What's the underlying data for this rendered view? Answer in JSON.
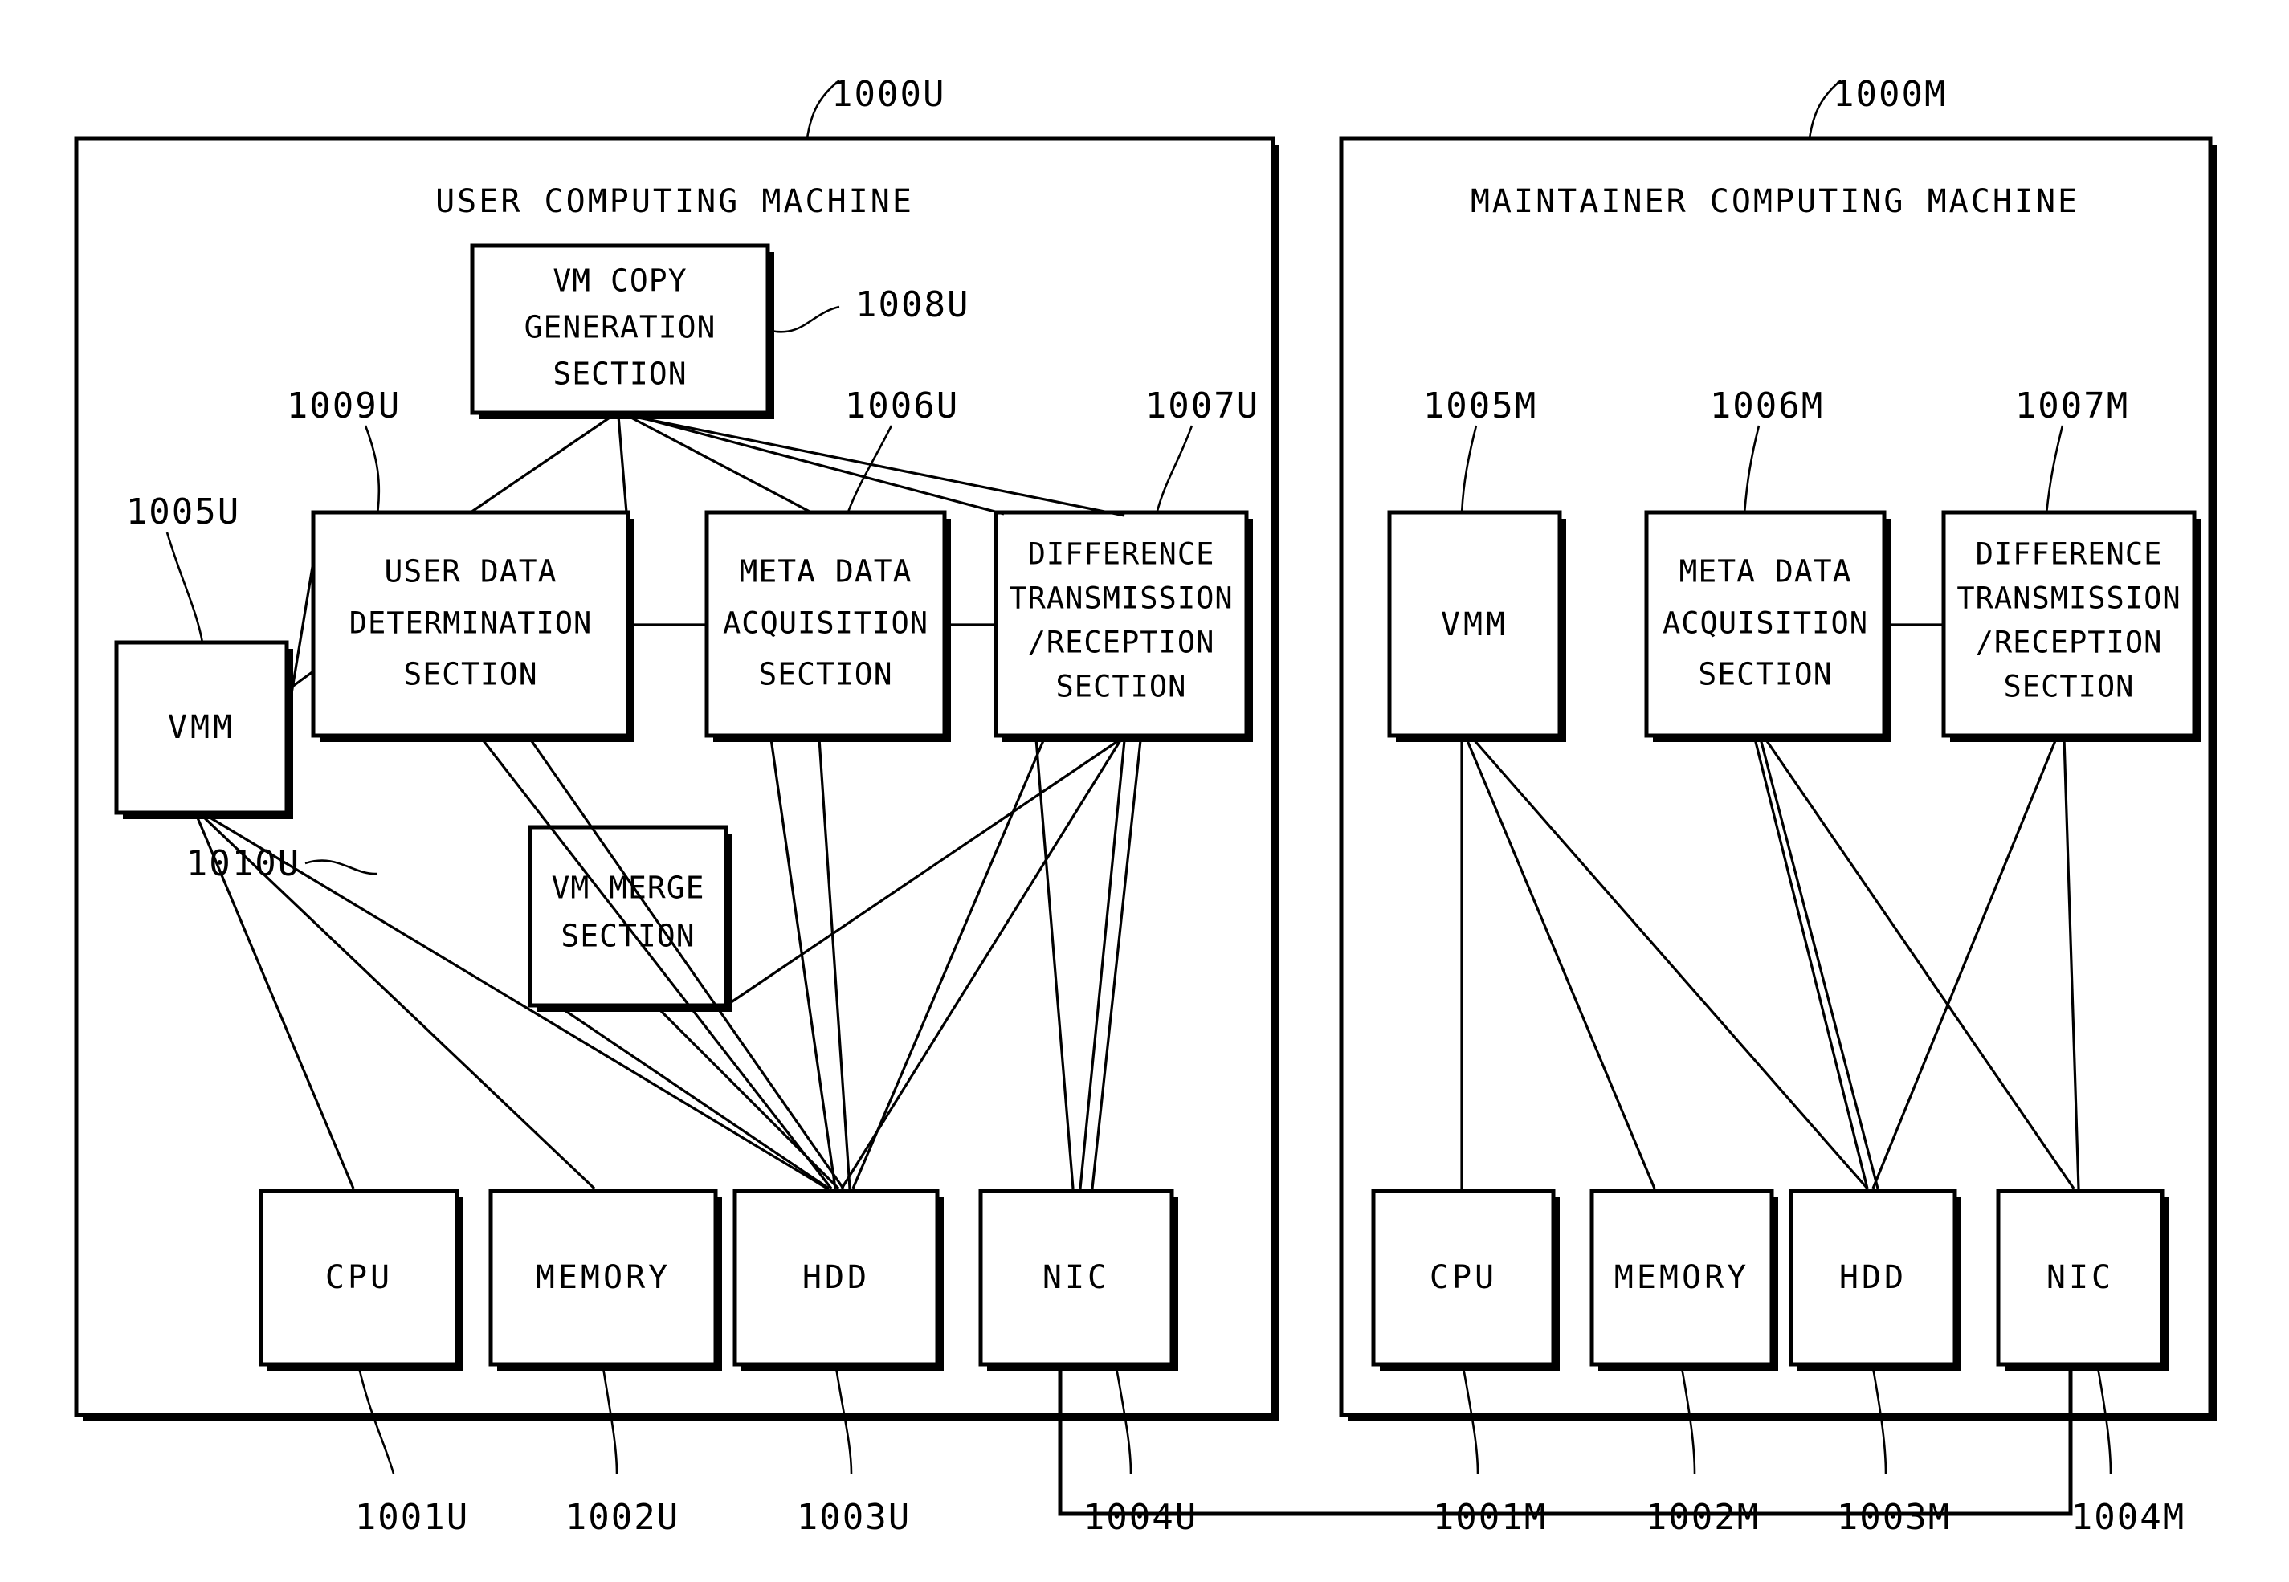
{
  "figure": {
    "type": "patent-block-diagram",
    "panels": [
      {
        "id": "user",
        "ref": "1000U",
        "title": "USER COMPUTING MACHINE",
        "blocks": [
          {
            "id": "vm_copy_gen",
            "ref": "1008U",
            "lines": [
              "VM COPY",
              "GENERATION",
              "SECTION"
            ]
          },
          {
            "id": "user_data_det",
            "ref": "1009U",
            "lines": [
              "USER DATA",
              "DETERMINATION",
              "SECTION"
            ]
          },
          {
            "id": "meta_data_acq",
            "ref": "1006U",
            "lines": [
              "META DATA",
              "ACQUISITION",
              "SECTION"
            ]
          },
          {
            "id": "diff_txrx",
            "ref": "1007U",
            "lines": [
              "DIFFERENCE",
              "TRANSMISSION",
              "/RECEPTION",
              "SECTION"
            ]
          },
          {
            "id": "vmm",
            "ref": "1005U",
            "lines": [
              "VMM"
            ]
          },
          {
            "id": "vm_merge",
            "ref": "1010U",
            "lines": [
              "VM MERGE",
              "SECTION"
            ]
          }
        ],
        "hardware": [
          {
            "id": "cpu",
            "ref": "1001U",
            "label": "CPU"
          },
          {
            "id": "memory",
            "ref": "1002U",
            "label": "MEMORY"
          },
          {
            "id": "hdd",
            "ref": "1003U",
            "label": "HDD"
          },
          {
            "id": "nic",
            "ref": "1004U",
            "label": "NIC"
          }
        ]
      },
      {
        "id": "maintainer",
        "ref": "1000M",
        "title": "MAINTAINER COMPUTING MACHINE",
        "blocks": [
          {
            "id": "vmm",
            "ref": "1005M",
            "lines": [
              "VMM"
            ]
          },
          {
            "id": "meta_data_acq",
            "ref": "1006M",
            "lines": [
              "META DATA",
              "ACQUISITION",
              "SECTION"
            ]
          },
          {
            "id": "diff_txrx",
            "ref": "1007M",
            "lines": [
              "DIFFERENCE",
              "TRANSMISSION",
              "/RECEPTION",
              "SECTION"
            ]
          }
        ],
        "hardware": [
          {
            "id": "cpu",
            "ref": "1001M",
            "label": "CPU"
          },
          {
            "id": "memory",
            "ref": "1002M",
            "label": "MEMORY"
          },
          {
            "id": "hdd",
            "ref": "1003M",
            "label": "HDD"
          },
          {
            "id": "nic",
            "ref": "1004M",
            "label": "NIC"
          }
        ]
      }
    ],
    "colors": {
      "ink": "#000000",
      "paper": "#ffffff"
    }
  },
  "labels": {
    "user_panel_ref": "1000U",
    "user_panel_title": "USER COMPUTING MACHINE",
    "maintainer_panel_ref": "1000M",
    "maintainer_panel_title": "MAINTAINER COMPUTING MACHINE",
    "u_vm_copy_l1": "VM COPY",
    "u_vm_copy_l2": "GENERATION",
    "u_vm_copy_l3": "SECTION",
    "u_vm_copy_ref": "1008U",
    "u_user_data_l1": "USER DATA",
    "u_user_data_l2": "DETERMINATION",
    "u_user_data_l3": "SECTION",
    "u_user_data_ref": "1009U",
    "u_meta_l1": "META DATA",
    "u_meta_l2": "ACQUISITION",
    "u_meta_l3": "SECTION",
    "u_meta_ref": "1006U",
    "u_diff_l1": "DIFFERENCE",
    "u_diff_l2": "TRANSMISSION",
    "u_diff_l3": "/RECEPTION",
    "u_diff_l4": "SECTION",
    "u_diff_ref": "1007U",
    "u_vmm": "VMM",
    "u_vmm_ref": "1005U",
    "u_merge_l1": "VM MERGE",
    "u_merge_l2": "SECTION",
    "u_merge_ref": "1010U",
    "u_cpu": "CPU",
    "u_cpu_ref": "1001U",
    "u_memory": "MEMORY",
    "u_memory_ref": "1002U",
    "u_hdd": "HDD",
    "u_hdd_ref": "1003U",
    "u_nic": "NIC",
    "u_nic_ref": "1004U",
    "m_vmm": "VMM",
    "m_vmm_ref": "1005M",
    "m_meta_l1": "META DATA",
    "m_meta_l2": "ACQUISITION",
    "m_meta_l3": "SECTION",
    "m_meta_ref": "1006M",
    "m_diff_l1": "DIFFERENCE",
    "m_diff_l2": "TRANSMISSION",
    "m_diff_l3": "/RECEPTION",
    "m_diff_l4": "SECTION",
    "m_diff_ref": "1007M",
    "m_cpu": "CPU",
    "m_cpu_ref": "1001M",
    "m_memory": "MEMORY",
    "m_memory_ref": "1002M",
    "m_hdd": "HDD",
    "m_hdd_ref": "1003M",
    "m_nic": "NIC",
    "m_nic_ref": "1004M"
  }
}
